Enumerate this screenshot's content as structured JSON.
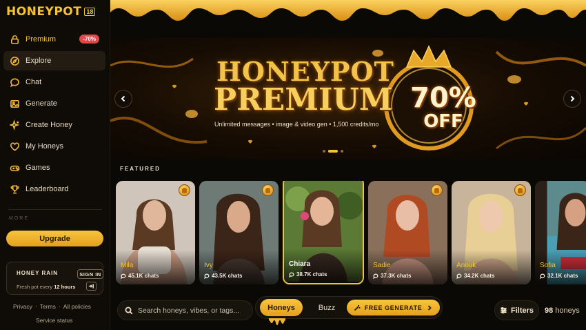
{
  "brand": {
    "logo_text": "HONEYPOT",
    "logo_badge": "18"
  },
  "sidebar": {
    "items": [
      {
        "label": "Premium",
        "icon": "lock-icon",
        "badge": "-70%"
      },
      {
        "label": "Explore",
        "icon": "compass-icon"
      },
      {
        "label": "Chat",
        "icon": "chat-bubble-icon"
      },
      {
        "label": "Generate",
        "icon": "image-icon"
      },
      {
        "label": "Create Honey",
        "icon": "sparkle-icon"
      },
      {
        "label": "My Honeys",
        "icon": "heart-icon"
      },
      {
        "label": "Games",
        "icon": "gamepad-icon"
      },
      {
        "label": "Leaderboard",
        "icon": "trophy-icon"
      }
    ],
    "more_label": "MORE",
    "upgrade_label": "Upgrade",
    "honey_rain": {
      "title": "HONEY RAIN",
      "signin_label": "SIGN IN",
      "subtitle_prefix": "Fresh pot every",
      "subtitle_bold": "12 hours"
    },
    "footer": {
      "privacy": "Privacy",
      "sep": "·",
      "terms": "Terms",
      "all_policies": "All policies",
      "service_status": "Service status"
    }
  },
  "banner": {
    "brand": "HONEYPOT",
    "headline": "PREMIUM",
    "tagline": "Unlimited messages • image & video gen • 1,500 credits/mo",
    "discount_pct": "70%",
    "discount_word": "OFF",
    "slide_count": 3,
    "active_slide": 1
  },
  "featured": {
    "label": "FEATURED",
    "cards": [
      {
        "name": "Mila",
        "chats": "45.1K chats"
      },
      {
        "name": "Ivy",
        "chats": "43.5K chats"
      },
      {
        "name": "Chiara",
        "chats": "38.7K chats"
      },
      {
        "name": "Sadie",
        "chats": "37.3K chats"
      },
      {
        "name": "Anouk",
        "chats": "34.2K chats"
      },
      {
        "name": "Sofia",
        "chats": "32.1K chats"
      }
    ]
  },
  "bottom": {
    "search_placeholder": "Search honeys, vibes, or tags...",
    "tab_honeys": "Honeys",
    "tab_buzz": "Buzz",
    "free_generate": "FREE GENERATE",
    "filters": "Filters",
    "count_number": "98",
    "count_label": "honeys"
  },
  "colors": {
    "accent": "#f5c430",
    "background": "#0b0906",
    "badge_red": "#e34848"
  }
}
